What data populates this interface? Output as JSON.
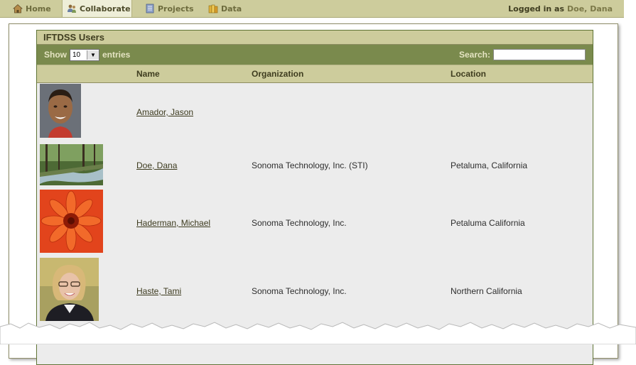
{
  "nav": {
    "tabs": [
      {
        "label": "Home",
        "icon": "home-icon"
      },
      {
        "label": "Collaborate",
        "icon": "people-icon",
        "active": true
      },
      {
        "label": "Projects",
        "icon": "notebook-icon"
      },
      {
        "label": "Data",
        "icon": "books-icon"
      }
    ],
    "login_prefix": "Logged in as",
    "login_user": "Doe, Dana"
  },
  "panel": {
    "title": "IFTDSS Users",
    "show_label": "Show",
    "entries_value": "10",
    "entries_label": "entries",
    "search_label": "Search:",
    "search_value": ""
  },
  "table": {
    "columns": [
      "",
      "Name",
      "Organization",
      "Location"
    ],
    "rows": [
      {
        "photo": "portrait-young-man",
        "name": "Amador, Jason",
        "organization": "",
        "location": ""
      },
      {
        "photo": "forest-stream",
        "name": "Doe, Dana",
        "organization": "Sonoma Technology, Inc. (STI)",
        "location": "Petaluma, California"
      },
      {
        "photo": "orange-flower",
        "name": "Haderman, Michael",
        "organization": "Sonoma Technology, Inc.",
        "location": "Petaluma California"
      },
      {
        "photo": "portrait-woman-glasses",
        "name": "Haste, Tami",
        "organization": "Sonoma Technology, Inc.",
        "location": "Northern California"
      }
    ]
  }
}
